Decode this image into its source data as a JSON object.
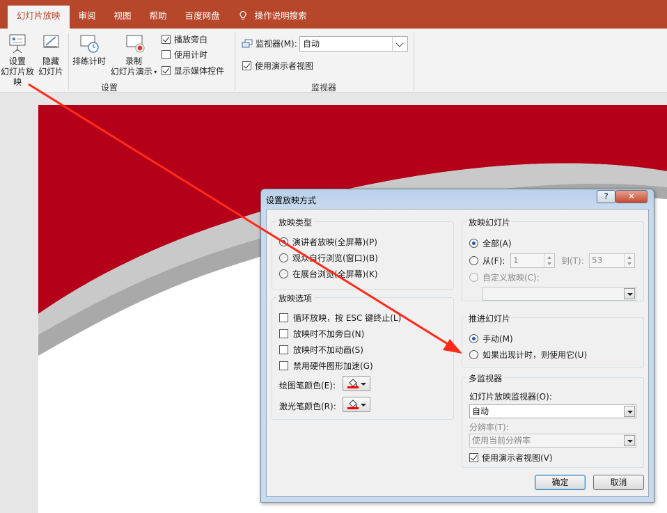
{
  "ribbon_tabs": {
    "slideshow": "幻灯片放映",
    "review": "审阅",
    "view": "视图",
    "help": "帮助",
    "baidu": "百度网盘",
    "search": "操作说明搜索"
  },
  "ribbon": {
    "setup_line1": "设置",
    "setup_line2": "幻灯片放映",
    "hide_line1": "隐藏",
    "hide_line2": "幻灯片",
    "rehearse": "排练计时",
    "record_line1": "录制",
    "record_line2": "幻灯片演示",
    "play_narrations": "播放旁白",
    "use_timings": "使用计时",
    "show_media_controls": "显示媒体控件",
    "group_setup": "设置",
    "monitor_label": "监视器(M):",
    "monitor_value": "自动",
    "use_presenter_view": "使用演示者视图",
    "group_monitors": "监视器"
  },
  "dialog": {
    "title": "设置放映方式",
    "help": "?",
    "close": "✕",
    "show_type": {
      "title": "放映类型",
      "presenter": "演讲者放映(全屏幕)(P)",
      "individual": "观众自行浏览(窗口)(B)",
      "kiosk": "在展台浏览(全屏幕)(K)"
    },
    "show_options": {
      "title": "放映选项",
      "loop": "循环放映，按 ESC 键终止(L)",
      "no_narration": "放映时不加旁白(N)",
      "no_animation": "放映时不加动画(S)",
      "disable_hw_accel": "禁用硬件图形加速(G)",
      "pen_color": "绘图笔颜色(E):",
      "laser_color": "激光笔颜色(R):"
    },
    "show_slides": {
      "title": "放映幻灯片",
      "all": "全部(A)",
      "from": "从(F):",
      "from_value": "1",
      "to": "到(T):",
      "to_value": "53",
      "custom": "自定义放映(C):",
      "custom_value": ""
    },
    "advance": {
      "title": "推进幻灯片",
      "manual": "手动(M)",
      "timings": "如果出现计时，则使用它(U)"
    },
    "multi_monitor": {
      "title": "多监视器",
      "monitor_label": "幻灯片放映监视器(O):",
      "monitor_value": "自动",
      "resolution_label": "分辨率(T):",
      "resolution_value": "使用当前分辨率",
      "presenter_view": "使用演示者视图(V)"
    },
    "ok": "确定",
    "cancel": "取消"
  },
  "colors": {
    "tab_bar": "#b7472a",
    "slide_red": "#b5001a",
    "arrow": "#ff2a1a",
    "pen_swatch": "#ff0000"
  }
}
